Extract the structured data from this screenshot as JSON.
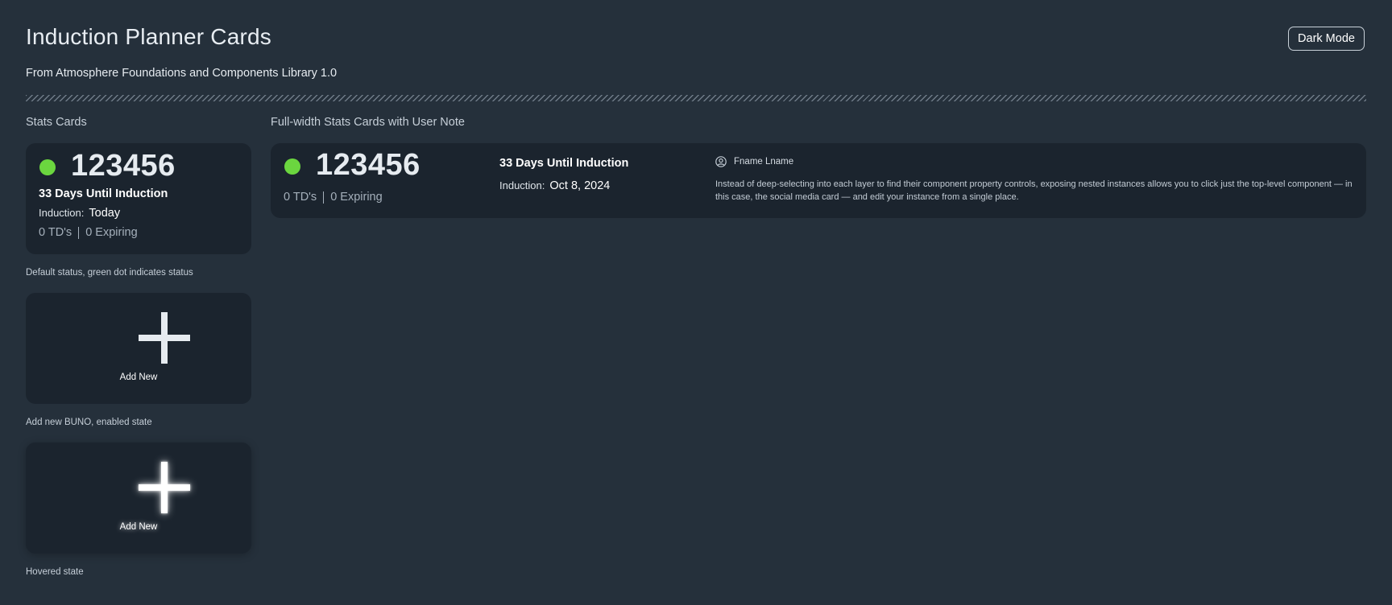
{
  "header": {
    "title": "Induction Planner Cards",
    "subtitle": "From Atmosphere Foundations and Components Library 1.0",
    "mode_button_label": "Dark Mode"
  },
  "colors": {
    "background": "#25303b",
    "card": "#1b242e",
    "status_green": "#6bd63f"
  },
  "stats_section": {
    "title": "Stats Cards",
    "default_card": {
      "number": "123456",
      "days_until": "33 Days Until Induction",
      "induction_label": "Induction:",
      "induction_value": "Today",
      "tds": "0 TD's",
      "expiring": "0 Expiring"
    },
    "default_caption": "Default status, green dot indicates status",
    "add_new_label": "Add New",
    "add_new_caption": "Add new BUNO, enabled state",
    "hover_add_new_label": "Add New",
    "hover_caption": "Hovered state"
  },
  "full_width_section": {
    "title": "Full-width Stats Cards with User Note",
    "card": {
      "number": "123456",
      "tds": "0 TD's",
      "expiring": "0 Expiring",
      "days_until": "33 Days Until Induction",
      "induction_label": "Induction:",
      "induction_value": "Oct 8, 2024",
      "user_name": "Fname Lname",
      "note": "Instead of deep-selecting into each layer to find their component property controls, exposing nested instances allows you to click just the top-level component — in this case, the social media card — and edit your instance from a single place."
    }
  },
  "icons": {
    "status": "status-dot-icon",
    "plus": "plus-icon",
    "user": "user-circle-icon"
  }
}
